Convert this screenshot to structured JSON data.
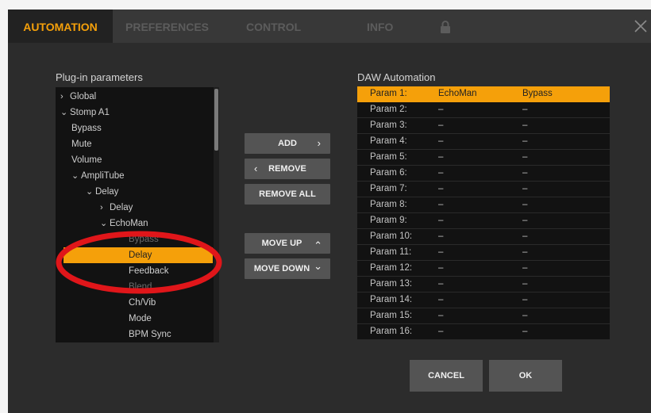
{
  "tabs": [
    {
      "label": "AUTOMATION",
      "active": true
    },
    {
      "label": "PREFERENCES",
      "active": false
    },
    {
      "label": "CONTROL",
      "active": false
    },
    {
      "label": "INFO",
      "active": false
    }
  ],
  "icons": {
    "lock": "lock-icon",
    "close": "close-icon"
  },
  "colors": {
    "accent": "#f5a00a",
    "highlight_ring": "#e0161a",
    "background": "#2c2c2c"
  },
  "plugin_panel": {
    "title": "Plug-in parameters",
    "items": [
      {
        "label": "Global",
        "chevron": "›",
        "depth": 0
      },
      {
        "label": "Stomp A1",
        "chevron": "⌄",
        "depth": 0
      },
      {
        "label": "Bypass",
        "chevron": "",
        "depth": 1
      },
      {
        "label": "Mute",
        "chevron": "",
        "depth": 1
      },
      {
        "label": "Volume",
        "chevron": "",
        "depth": 1
      },
      {
        "label": "AmpliTube",
        "chevron": "⌄",
        "depth": 1
      },
      {
        "label": "Delay",
        "chevron": "⌄",
        "depth": 2
      },
      {
        "label": "Delay",
        "chevron": "›",
        "depth": 3
      },
      {
        "label": "EchoMan",
        "chevron": "⌄",
        "depth": 3
      },
      {
        "label": "Bypass",
        "chevron": "",
        "depth": 4,
        "dim": true
      },
      {
        "label": "Delay",
        "chevron": "",
        "depth": 4,
        "selected": true
      },
      {
        "label": "Feedback",
        "chevron": "",
        "depth": 4
      },
      {
        "label": "Blend",
        "chevron": "",
        "depth": 4,
        "dim": true
      },
      {
        "label": "Ch/Vib",
        "chevron": "",
        "depth": 4
      },
      {
        "label": "Mode",
        "chevron": "",
        "depth": 4
      },
      {
        "label": "BPM Sync",
        "chevron": "",
        "depth": 4
      }
    ]
  },
  "buttons": {
    "add": {
      "label": "ADD",
      "arrow": "›"
    },
    "remove": {
      "label": "REMOVE",
      "arrow": "‹"
    },
    "remove_all": {
      "label": "REMOVE ALL"
    },
    "move_up": {
      "label": "MOVE UP",
      "arrow": "⌃"
    },
    "move_down": {
      "label": "MOVE DOWN",
      "arrow": "⌄"
    }
  },
  "daw_panel": {
    "title": "DAW Automation",
    "rows": [
      {
        "name": "Param 1:",
        "plugin": "EchoMan",
        "param": "Bypass",
        "selected": true
      },
      {
        "name": "Param 2:",
        "plugin": "–",
        "param": "–"
      },
      {
        "name": "Param 3:",
        "plugin": "–",
        "param": "–"
      },
      {
        "name": "Param 4:",
        "plugin": "–",
        "param": "–"
      },
      {
        "name": "Param 5:",
        "plugin": "–",
        "param": "–"
      },
      {
        "name": "Param 6:",
        "plugin": "–",
        "param": "–"
      },
      {
        "name": "Param 7:",
        "plugin": "–",
        "param": "–"
      },
      {
        "name": "Param 8:",
        "plugin": "–",
        "param": "–"
      },
      {
        "name": "Param 9:",
        "plugin": "–",
        "param": "–"
      },
      {
        "name": "Param 10:",
        "plugin": "–",
        "param": "–"
      },
      {
        "name": "Param 11:",
        "plugin": "–",
        "param": "–"
      },
      {
        "name": "Param 12:",
        "plugin": "–",
        "param": "–"
      },
      {
        "name": "Param 13:",
        "plugin": "–",
        "param": "–"
      },
      {
        "name": "Param 14:",
        "plugin": "–",
        "param": "–"
      },
      {
        "name": "Param 15:",
        "plugin": "–",
        "param": "–"
      },
      {
        "name": "Param 16:",
        "plugin": "–",
        "param": "–"
      }
    ]
  },
  "dialog": {
    "cancel": "CANCEL",
    "ok": "OK"
  }
}
